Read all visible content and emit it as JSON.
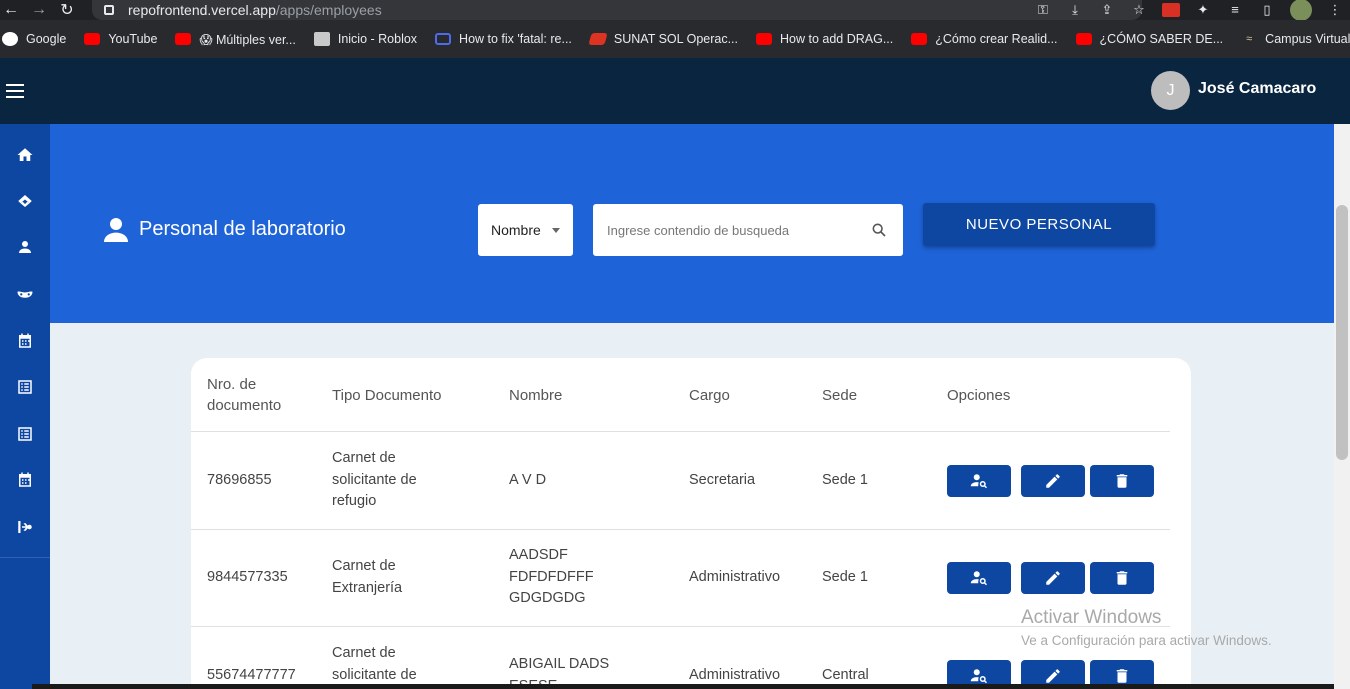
{
  "browser": {
    "url_host": "repofrontend.vercel.app",
    "url_path": "/apps/employees",
    "bookmarks": [
      {
        "label": "Google",
        "icon": "google-icon"
      },
      {
        "label": "YouTube",
        "icon": "youtube-icon"
      },
      {
        "label": "😱 Múltiples ver...",
        "icon": "youtube-icon"
      },
      {
        "label": "Inicio - Roblox",
        "icon": "roblox-icon"
      },
      {
        "label": "How to fix 'fatal: re...",
        "icon": "github-icon"
      },
      {
        "label": "SUNAT SOL Operac...",
        "icon": "sunat-icon"
      },
      {
        "label": "How to add DRAG...",
        "icon": "youtube-icon"
      },
      {
        "label": "¿Cómo crear Realid...",
        "icon": "youtube-icon"
      },
      {
        "label": "¿CÓMO SABER DE...",
        "icon": "youtube-icon"
      },
      {
        "label": "Campus Virtual",
        "icon": "campus-icon"
      }
    ],
    "more": "»"
  },
  "header": {
    "avatar_initial": "J",
    "user_name": "José Camacaro"
  },
  "sidebar": {
    "items": [
      "home-icon",
      "handshake-icon",
      "person-icon",
      "mask-icon",
      "calendar-icon",
      "list-icon",
      "list-icon",
      "calendar-icon",
      "flow-icon"
    ]
  },
  "page": {
    "title": "Personal de laboratorio",
    "filter_selected": "Nombre",
    "search_placeholder": "Ingrese contendio de busqueda",
    "new_button": "NUEVO PERSONAL"
  },
  "table": {
    "headers": [
      "Nro. de documento",
      "Tipo Documento",
      "Nombre",
      "Cargo",
      "Sede",
      "Opciones"
    ],
    "rows": [
      {
        "doc": "78696855",
        "tipo": "Carnet de solicitante de refugio",
        "nombre": "A V D",
        "cargo": "Secretaria",
        "sede": "Sede 1"
      },
      {
        "doc": "9844577335",
        "tipo": "Carnet de Extranjería",
        "nombre": "AADSDF FDFDFDFFF GDGDGDG",
        "cargo": "Administrativo",
        "sede": "Sede 1"
      },
      {
        "doc": "55674477777",
        "tipo": "Carnet de solicitante de",
        "nombre": "ABIGAIL DADS ESESE",
        "cargo": "Administrativo",
        "sede": "Central"
      }
    ]
  },
  "watermark": {
    "line1": "Activar Windows",
    "line2": "Ve a Configuración para activar Windows."
  },
  "colors": {
    "appbar": "#0a2540",
    "sidebar": "#0d47a1",
    "hero": "#1e63d8",
    "button": "#0d47a1"
  }
}
